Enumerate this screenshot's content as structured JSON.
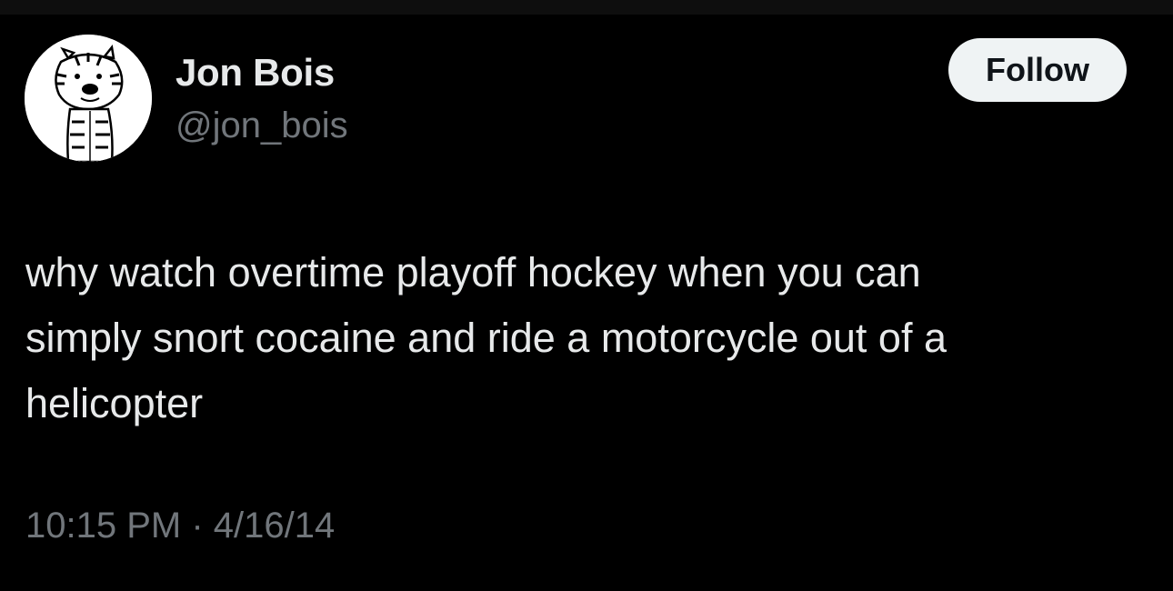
{
  "tweet": {
    "author": {
      "display_name": "Jon Bois",
      "handle": "@jon_bois",
      "avatar_icon": "cartoon-tiger-avatar"
    },
    "follow_label": "Follow",
    "text_lines": [
      "why watch overtime playoff hockey when you can",
      "simply snort cocaine and ride a motorcycle out of a",
      "helicopter"
    ],
    "time": "10:15 PM",
    "separator": "·",
    "date": "4/16/14"
  },
  "colors": {
    "background": "#000000",
    "primary_text": "#e7e9ea",
    "secondary_text": "#71767b",
    "button_bg": "#eff3f4",
    "button_text": "#0f1419"
  }
}
